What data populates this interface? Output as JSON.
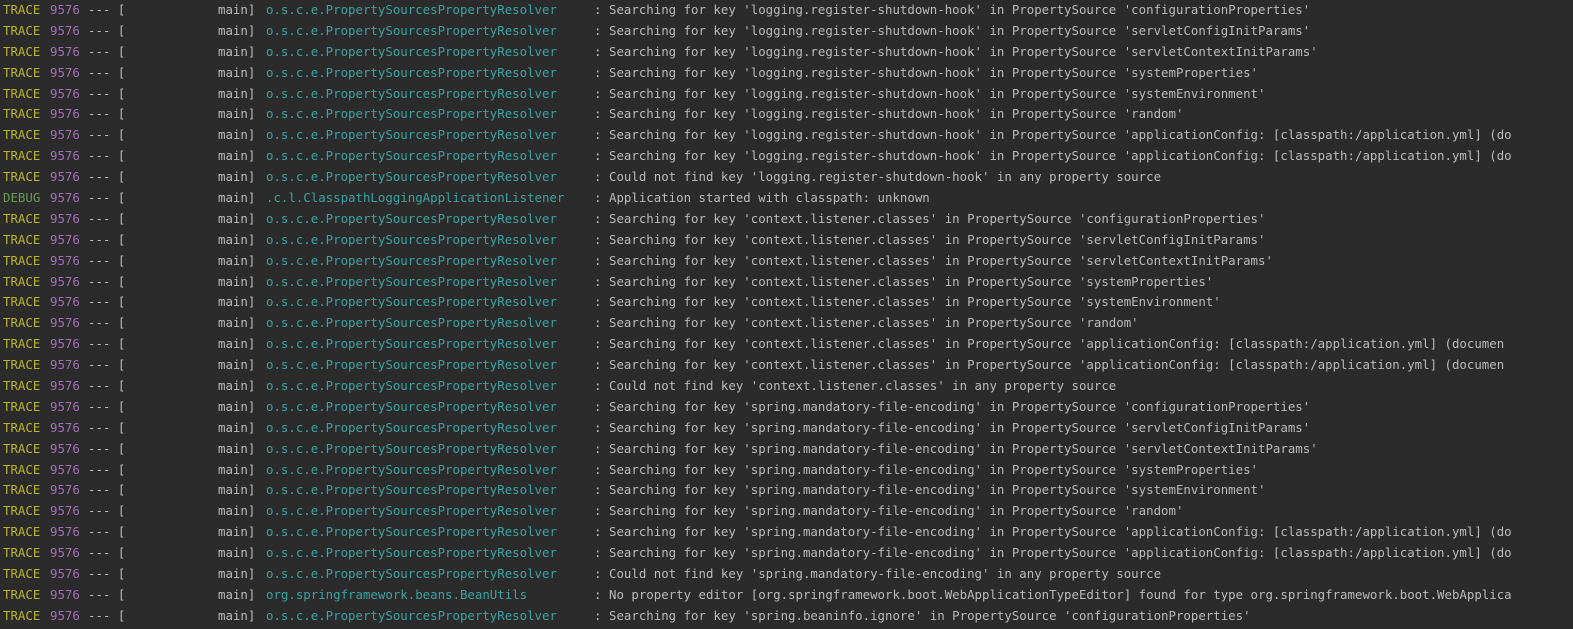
{
  "colors": {
    "background": "#2b2b2b",
    "trace_level": "#bbb529",
    "debug_level": "#6a9955",
    "pid": "#a26fb8",
    "logger": "#3aa3a3",
    "text": "#bbbbbb"
  },
  "lines": [
    {
      "level": "TRACE",
      "pid": "9576",
      "sep": "--- [",
      "thread": "main]",
      "logger": "o.s.c.e.PropertySourcesPropertyResolver",
      "colon": ":",
      "message": "Searching for key 'logging.register-shutdown-hook' in PropertySource 'configurationProperties'"
    },
    {
      "level": "TRACE",
      "pid": "9576",
      "sep": "--- [",
      "thread": "main]",
      "logger": "o.s.c.e.PropertySourcesPropertyResolver",
      "colon": ":",
      "message": "Searching for key 'logging.register-shutdown-hook' in PropertySource 'servletConfigInitParams'"
    },
    {
      "level": "TRACE",
      "pid": "9576",
      "sep": "--- [",
      "thread": "main]",
      "logger": "o.s.c.e.PropertySourcesPropertyResolver",
      "colon": ":",
      "message": "Searching for key 'logging.register-shutdown-hook' in PropertySource 'servletContextInitParams'"
    },
    {
      "level": "TRACE",
      "pid": "9576",
      "sep": "--- [",
      "thread": "main]",
      "logger": "o.s.c.e.PropertySourcesPropertyResolver",
      "colon": ":",
      "message": "Searching for key 'logging.register-shutdown-hook' in PropertySource 'systemProperties'"
    },
    {
      "level": "TRACE",
      "pid": "9576",
      "sep": "--- [",
      "thread": "main]",
      "logger": "o.s.c.e.PropertySourcesPropertyResolver",
      "colon": ":",
      "message": "Searching for key 'logging.register-shutdown-hook' in PropertySource 'systemEnvironment'"
    },
    {
      "level": "TRACE",
      "pid": "9576",
      "sep": "--- [",
      "thread": "main]",
      "logger": "o.s.c.e.PropertySourcesPropertyResolver",
      "colon": ":",
      "message": "Searching for key 'logging.register-shutdown-hook' in PropertySource 'random'"
    },
    {
      "level": "TRACE",
      "pid": "9576",
      "sep": "--- [",
      "thread": "main]",
      "logger": "o.s.c.e.PropertySourcesPropertyResolver",
      "colon": ":",
      "message": "Searching for key 'logging.register-shutdown-hook' in PropertySource 'applicationConfig: [classpath:/application.yml] (do"
    },
    {
      "level": "TRACE",
      "pid": "9576",
      "sep": "--- [",
      "thread": "main]",
      "logger": "o.s.c.e.PropertySourcesPropertyResolver",
      "colon": ":",
      "message": "Searching for key 'logging.register-shutdown-hook' in PropertySource 'applicationConfig: [classpath:/application.yml] (do"
    },
    {
      "level": "TRACE",
      "pid": "9576",
      "sep": "--- [",
      "thread": "main]",
      "logger": "o.s.c.e.PropertySourcesPropertyResolver",
      "colon": ":",
      "message": "Could not find key 'logging.register-shutdown-hook' in any property source"
    },
    {
      "level": "DEBUG",
      "pid": "9576",
      "sep": "--- [",
      "thread": "main]",
      "logger": ".c.l.ClasspathLoggingApplicationListener",
      "colon": ":",
      "message": "Application started with classpath: unknown"
    },
    {
      "level": "TRACE",
      "pid": "9576",
      "sep": "--- [",
      "thread": "main]",
      "logger": "o.s.c.e.PropertySourcesPropertyResolver",
      "colon": ":",
      "message": "Searching for key 'context.listener.classes' in PropertySource 'configurationProperties'"
    },
    {
      "level": "TRACE",
      "pid": "9576",
      "sep": "--- [",
      "thread": "main]",
      "logger": "o.s.c.e.PropertySourcesPropertyResolver",
      "colon": ":",
      "message": "Searching for key 'context.listener.classes' in PropertySource 'servletConfigInitParams'"
    },
    {
      "level": "TRACE",
      "pid": "9576",
      "sep": "--- [",
      "thread": "main]",
      "logger": "o.s.c.e.PropertySourcesPropertyResolver",
      "colon": ":",
      "message": "Searching for key 'context.listener.classes' in PropertySource 'servletContextInitParams'"
    },
    {
      "level": "TRACE",
      "pid": "9576",
      "sep": "--- [",
      "thread": "main]",
      "logger": "o.s.c.e.PropertySourcesPropertyResolver",
      "colon": ":",
      "message": "Searching for key 'context.listener.classes' in PropertySource 'systemProperties'"
    },
    {
      "level": "TRACE",
      "pid": "9576",
      "sep": "--- [",
      "thread": "main]",
      "logger": "o.s.c.e.PropertySourcesPropertyResolver",
      "colon": ":",
      "message": "Searching for key 'context.listener.classes' in PropertySource 'systemEnvironment'"
    },
    {
      "level": "TRACE",
      "pid": "9576",
      "sep": "--- [",
      "thread": "main]",
      "logger": "o.s.c.e.PropertySourcesPropertyResolver",
      "colon": ":",
      "message": "Searching for key 'context.listener.classes' in PropertySource 'random'"
    },
    {
      "level": "TRACE",
      "pid": "9576",
      "sep": "--- [",
      "thread": "main]",
      "logger": "o.s.c.e.PropertySourcesPropertyResolver",
      "colon": ":",
      "message": "Searching for key 'context.listener.classes' in PropertySource 'applicationConfig: [classpath:/application.yml] (documen"
    },
    {
      "level": "TRACE",
      "pid": "9576",
      "sep": "--- [",
      "thread": "main]",
      "logger": "o.s.c.e.PropertySourcesPropertyResolver",
      "colon": ":",
      "message": "Searching for key 'context.listener.classes' in PropertySource 'applicationConfig: [classpath:/application.yml] (documen"
    },
    {
      "level": "TRACE",
      "pid": "9576",
      "sep": "--- [",
      "thread": "main]",
      "logger": "o.s.c.e.PropertySourcesPropertyResolver",
      "colon": ":",
      "message": "Could not find key 'context.listener.classes' in any property source"
    },
    {
      "level": "TRACE",
      "pid": "9576",
      "sep": "--- [",
      "thread": "main]",
      "logger": "o.s.c.e.PropertySourcesPropertyResolver",
      "colon": ":",
      "message": "Searching for key 'spring.mandatory-file-encoding' in PropertySource 'configurationProperties'"
    },
    {
      "level": "TRACE",
      "pid": "9576",
      "sep": "--- [",
      "thread": "main]",
      "logger": "o.s.c.e.PropertySourcesPropertyResolver",
      "colon": ":",
      "message": "Searching for key 'spring.mandatory-file-encoding' in PropertySource 'servletConfigInitParams'"
    },
    {
      "level": "TRACE",
      "pid": "9576",
      "sep": "--- [",
      "thread": "main]",
      "logger": "o.s.c.e.PropertySourcesPropertyResolver",
      "colon": ":",
      "message": "Searching for key 'spring.mandatory-file-encoding' in PropertySource 'servletContextInitParams'"
    },
    {
      "level": "TRACE",
      "pid": "9576",
      "sep": "--- [",
      "thread": "main]",
      "logger": "o.s.c.e.PropertySourcesPropertyResolver",
      "colon": ":",
      "message": "Searching for key 'spring.mandatory-file-encoding' in PropertySource 'systemProperties'"
    },
    {
      "level": "TRACE",
      "pid": "9576",
      "sep": "--- [",
      "thread": "main]",
      "logger": "o.s.c.e.PropertySourcesPropertyResolver",
      "colon": ":",
      "message": "Searching for key 'spring.mandatory-file-encoding' in PropertySource 'systemEnvironment'"
    },
    {
      "level": "TRACE",
      "pid": "9576",
      "sep": "--- [",
      "thread": "main]",
      "logger": "o.s.c.e.PropertySourcesPropertyResolver",
      "colon": ":",
      "message": "Searching for key 'spring.mandatory-file-encoding' in PropertySource 'random'"
    },
    {
      "level": "TRACE",
      "pid": "9576",
      "sep": "--- [",
      "thread": "main]",
      "logger": "o.s.c.e.PropertySourcesPropertyResolver",
      "colon": ":",
      "message": "Searching for key 'spring.mandatory-file-encoding' in PropertySource 'applicationConfig: [classpath:/application.yml] (do"
    },
    {
      "level": "TRACE",
      "pid": "9576",
      "sep": "--- [",
      "thread": "main]",
      "logger": "o.s.c.e.PropertySourcesPropertyResolver",
      "colon": ":",
      "message": "Searching for key 'spring.mandatory-file-encoding' in PropertySource 'applicationConfig: [classpath:/application.yml] (do"
    },
    {
      "level": "TRACE",
      "pid": "9576",
      "sep": "--- [",
      "thread": "main]",
      "logger": "o.s.c.e.PropertySourcesPropertyResolver",
      "colon": ":",
      "message": "Could not find key 'spring.mandatory-file-encoding' in any property source"
    },
    {
      "level": "TRACE",
      "pid": "9576",
      "sep": "--- [",
      "thread": "main]",
      "logger": "org.springframework.beans.BeanUtils",
      "colon": ":",
      "message": "No property editor [org.springframework.boot.WebApplicationTypeEditor] found for type org.springframework.boot.WebApplica"
    },
    {
      "level": "TRACE",
      "pid": "9576",
      "sep": "--- [",
      "thread": "main]",
      "logger": "o.s.c.e.PropertySourcesPropertyResolver",
      "colon": ":",
      "message": "Searching for key 'spring.beaninfo.ignore' in PropertySource 'configurationProperties'"
    }
  ]
}
